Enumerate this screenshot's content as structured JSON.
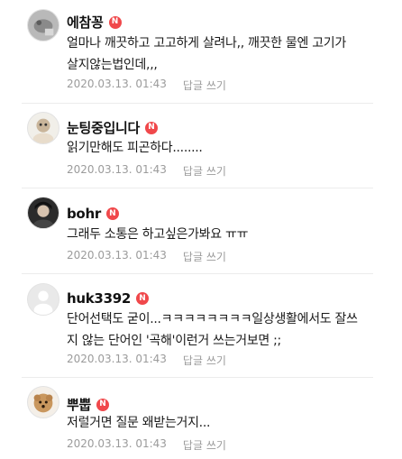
{
  "comments": [
    {
      "nickname": "에참꽁",
      "badge": "N",
      "text": "얼마나 깨끗하고 고고하게 살려나,, 깨끗한 물엔 고기가\n살지않는법인데,,,",
      "date": "2020.03.13. 01:43",
      "reply_label": "답글 쓰기"
    },
    {
      "nickname": "눈팅중입니다",
      "badge": "N",
      "text": "읽기만해도 피곤하다........",
      "date": "2020.03.13. 01:43",
      "reply_label": "답글 쓰기"
    },
    {
      "nickname": "bohr",
      "badge": "N",
      "text": "그래두 소통은 하고싶은가봐요 ㅠㅠ",
      "date": "2020.03.13. 01:43",
      "reply_label": "답글 쓰기"
    },
    {
      "nickname": "huk3392",
      "badge": "N",
      "text": "단어선택도 굳이...ㅋㅋㅋㅋㅋㅋㅋㅋ일상생활에서도 잘쓰\n지 않는 단어인 '곡해'이런거 쓰는거보면 ;;",
      "date": "2020.03.13. 01:43",
      "reply_label": "답글 쓰기"
    },
    {
      "nickname": "뿌뿝",
      "badge": "N",
      "text": "저럴거면 질문 왜받는거지...",
      "date": "2020.03.13. 01:43",
      "reply_label": "답글 쓰기"
    }
  ]
}
